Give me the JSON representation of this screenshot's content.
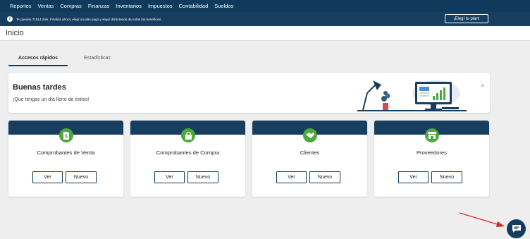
{
  "nav": {
    "items": [
      "Reportes",
      "Ventas",
      "Compras",
      "Finanzas",
      "Inventarios",
      "Impuestos",
      "Contabilidad",
      "Sueldos"
    ]
  },
  "banner": {
    "message": "Te quedan 71914 días. Finalizá ahora, elegí un plan pago y seguí disfrutando de todos los beneficios.",
    "button_label": "¡Elegí tu plan!"
  },
  "page": {
    "title": "Inicio"
  },
  "tabs": [
    {
      "label": "Accesos rápidos",
      "active": true
    },
    {
      "label": "Estadísticas",
      "active": false
    }
  ],
  "greeting": {
    "title": "Buenas tardes",
    "subtitle": "¡Que tengas un día lleno de éxitos!"
  },
  "quick_access": [
    {
      "label": "Comprobantes de Venta",
      "icon": "invoice-icon",
      "ver": "Ver",
      "nuevo": "Nuevo"
    },
    {
      "label": "Comprobantes de Compra",
      "icon": "shopping-bag-icon",
      "ver": "Ver",
      "nuevo": "Nuevo"
    },
    {
      "label": "Clientes",
      "icon": "handshake-icon",
      "ver": "Ver",
      "nuevo": "Nuevo"
    },
    {
      "label": "Proveedores",
      "icon": "store-icon",
      "ver": "Ver",
      "nuevo": "Nuevo"
    }
  ],
  "colors": {
    "nav_bg": "#0f3a5b",
    "card_header": "#173e5e",
    "icon_green": "#4ea83c",
    "arrow_red": "#d9262b"
  }
}
